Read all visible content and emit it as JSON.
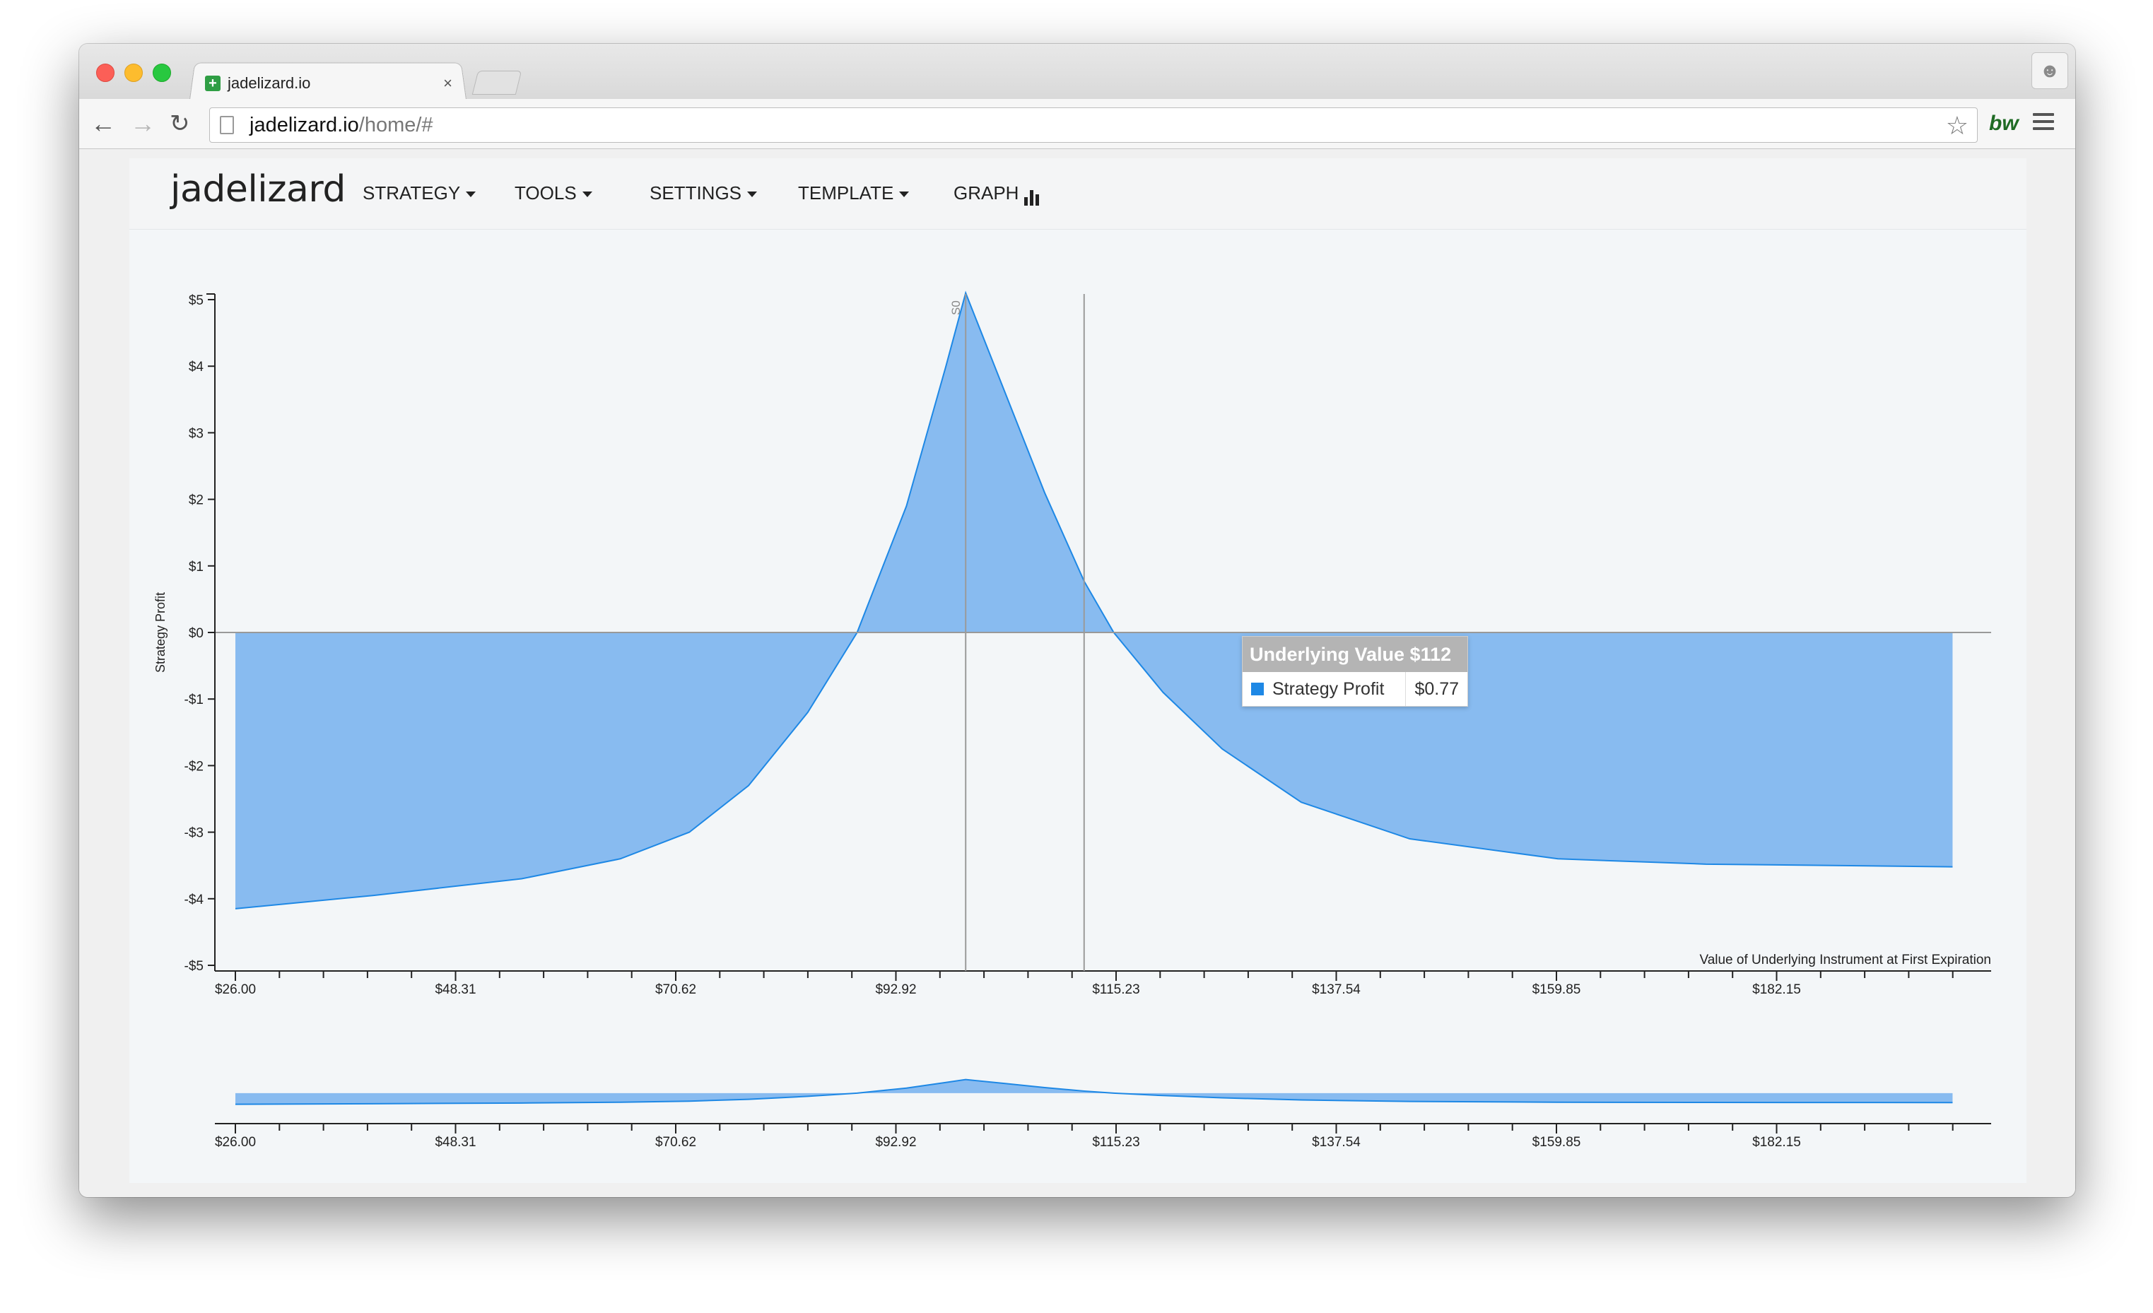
{
  "browser": {
    "tab_title": "jadelizard.io",
    "tab_close": "×",
    "url_host": "jadelizard.io",
    "url_path": "/home/#",
    "back_icon": "←",
    "forward_icon": "→",
    "reload_icon": "↻",
    "star_icon": "☆",
    "extension_label": "bw"
  },
  "navbar": {
    "brand": "jadelizard",
    "items": [
      {
        "label": "STRATEGY"
      },
      {
        "label": "TOOLS"
      },
      {
        "label": "SETTINGS"
      },
      {
        "label": "TEMPLATE"
      },
      {
        "label": "GRAPH"
      }
    ]
  },
  "tooltip": {
    "title": "Underlying Value $112",
    "series_label": "Strategy Profit",
    "value": "$0.77",
    "swatch_color": "#1e88e5"
  },
  "chart_data": [
    {
      "type": "area",
      "ylabel": "Strategy Profit",
      "xlabel": "Value of Underlying Instrument at First Expiration",
      "ylim": [
        -5,
        5
      ],
      "xlim": [
        26.0,
        200
      ],
      "y_ticks": [
        "$5",
        "$4",
        "$3",
        "$2",
        "$1",
        "$0",
        "-$1",
        "-$2",
        "-$3",
        "-$4",
        "-$5"
      ],
      "x_ticks": [
        "$26.00",
        "$48.31",
        "$70.62",
        "$92.92",
        "$115.23",
        "$137.54",
        "$159.85",
        "$182.15"
      ],
      "reference_line": {
        "label": "S0",
        "x": 100
      },
      "hover_line": {
        "x": 112
      },
      "fill_color": "#88bbf0",
      "line_color": "#1e88e5",
      "series": [
        {
          "name": "Strategy Profit",
          "x": [
            26,
            40,
            55,
            65,
            72,
            78,
            84,
            89,
            94,
            98,
            100,
            104,
            108,
            112,
            115,
            120,
            126,
            134,
            145,
            160,
            175,
            200
          ],
          "values": [
            -4.15,
            -3.95,
            -3.7,
            -3.4,
            -3.0,
            -2.3,
            -1.2,
            0.0,
            1.9,
            4.0,
            5.1,
            3.6,
            2.1,
            0.77,
            0.0,
            -0.9,
            -1.75,
            -2.55,
            -3.1,
            -3.4,
            -3.48,
            -3.52
          ]
        }
      ]
    },
    {
      "type": "area",
      "x_ticks": [
        "$26.00",
        "$48.31",
        "$70.62",
        "$92.92",
        "$115.23",
        "$137.54",
        "$159.85",
        "$182.15"
      ],
      "ylim": [
        -5,
        5
      ],
      "xlim": [
        26.0,
        200
      ],
      "series": [
        {
          "name": "Strategy Profit",
          "x": [
            26,
            40,
            55,
            65,
            72,
            78,
            84,
            89,
            94,
            98,
            100,
            104,
            108,
            112,
            115,
            120,
            126,
            134,
            145,
            160,
            175,
            200
          ],
          "values": [
            -4.15,
            -3.95,
            -3.7,
            -3.4,
            -3.0,
            -2.3,
            -1.2,
            0.0,
            1.9,
            4.0,
            5.1,
            3.6,
            2.1,
            0.77,
            0.0,
            -0.9,
            -1.75,
            -2.55,
            -3.1,
            -3.4,
            -3.48,
            -3.52
          ]
        }
      ]
    }
  ]
}
